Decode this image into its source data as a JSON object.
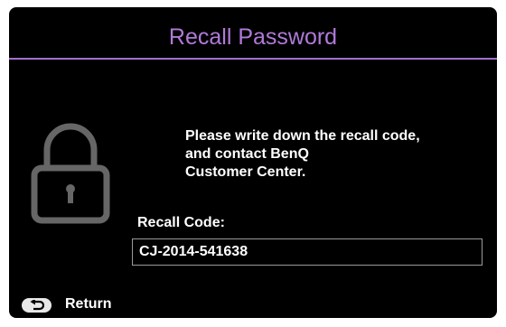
{
  "dialog": {
    "title": "Recall Password",
    "message_lines": [
      "Please write down the recall code,",
      "and contact BenQ",
      "Customer Center."
    ],
    "recall_code_label": "Recall Code:",
    "recall_code_value": "CJ-2014-541638",
    "return_label": "Return"
  },
  "icons": {
    "lock": "lock-icon",
    "return": "return-arrow-icon"
  },
  "colors": {
    "title": "#b07ad8",
    "divider": "#a070d0",
    "background": "#000000",
    "text": "#ffffff",
    "lock_icon": "#666666"
  }
}
